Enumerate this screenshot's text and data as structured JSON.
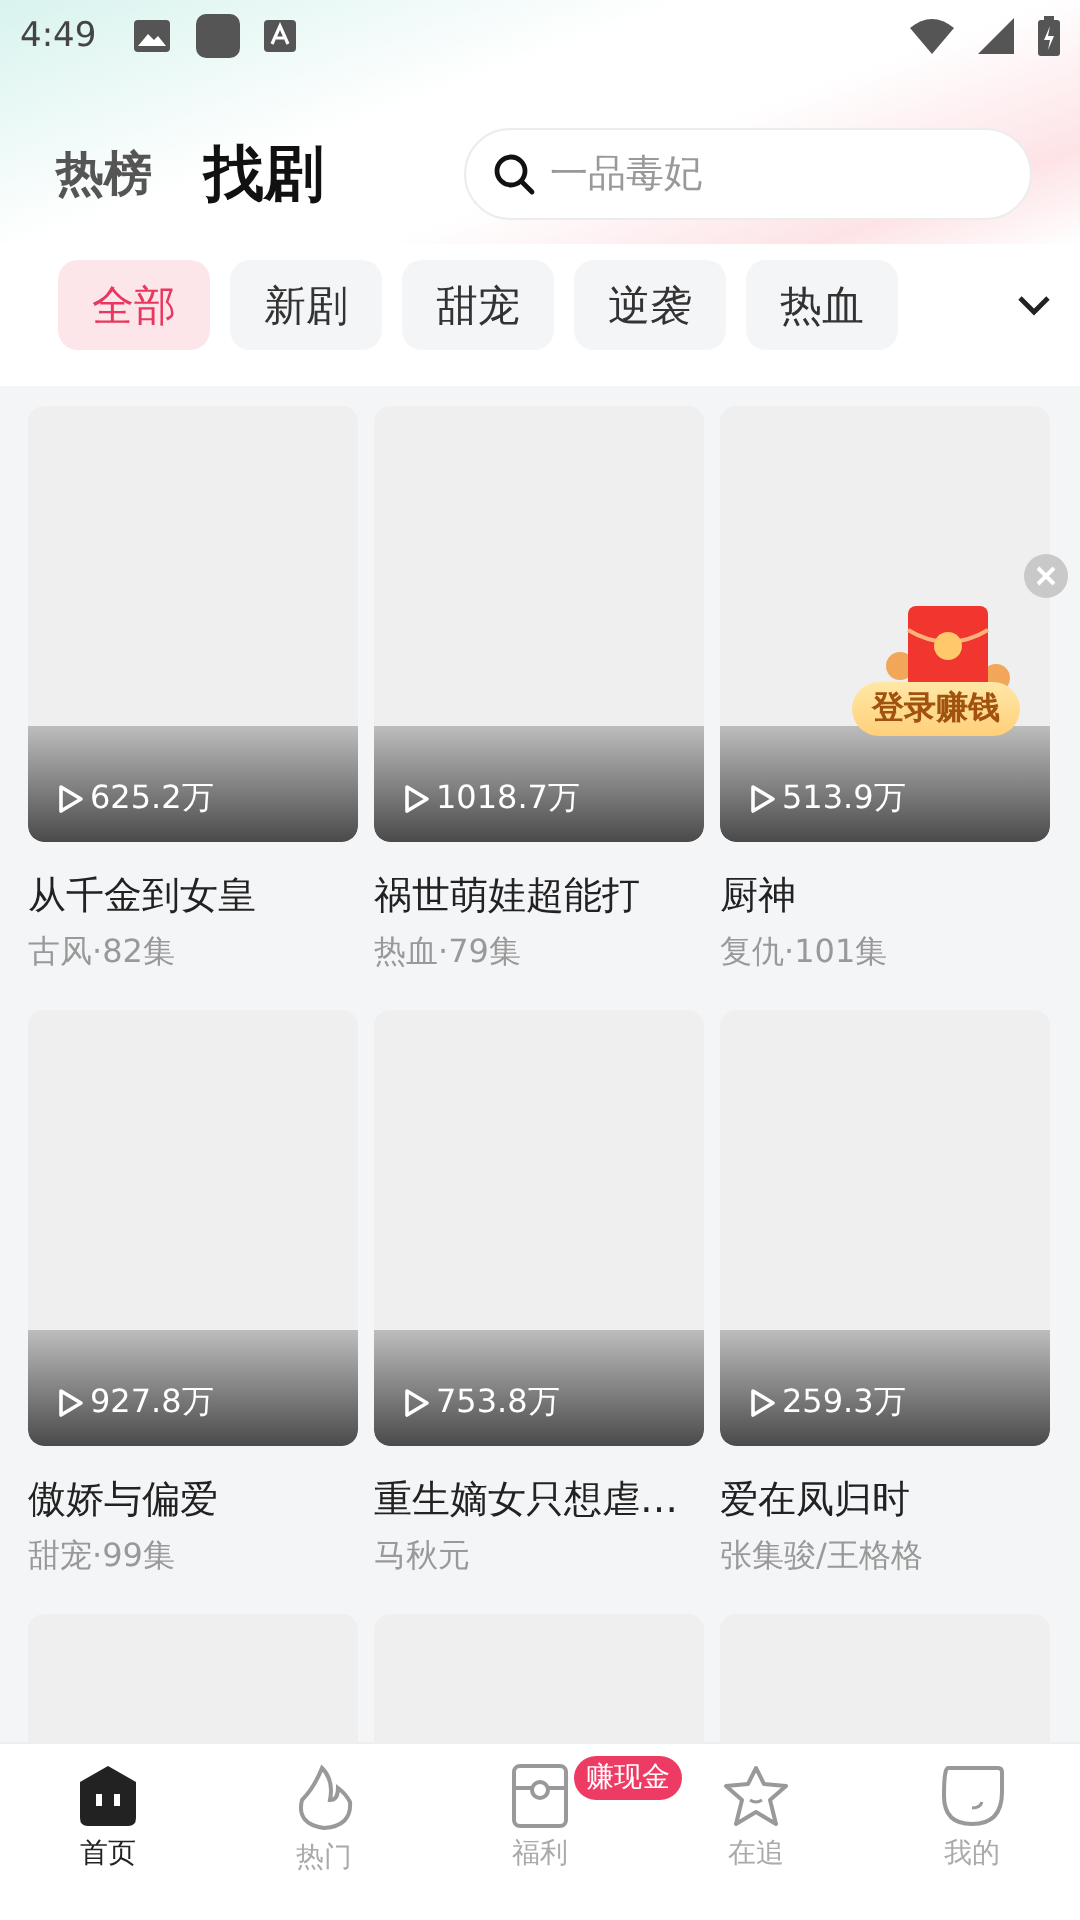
{
  "status_bar": {
    "time": "4:49"
  },
  "tabs": [
    {
      "label": "热榜",
      "selected": false
    },
    {
      "label": "找剧",
      "selected": true
    }
  ],
  "search": {
    "placeholder": "一品毒妃"
  },
  "categories": [
    {
      "label": "全部",
      "selected": true
    },
    {
      "label": "新剧",
      "selected": false
    },
    {
      "label": "甜宠",
      "selected": false
    },
    {
      "label": "逆袭",
      "selected": false
    },
    {
      "label": "热血",
      "selected": false
    }
  ],
  "dramas": [
    {
      "kind": "drama",
      "plays": "625.2万",
      "title": "从千金到女皇",
      "meta": "古风·82集"
    },
    {
      "kind": "drama",
      "plays": "1018.7万",
      "title": "祸世萌娃超能打",
      "meta": "热血·79集"
    },
    {
      "kind": "drama",
      "plays": "513.9万",
      "title": "厨神",
      "meta": "复仇·101集"
    },
    {
      "kind": "drama",
      "plays": "927.8万",
      "title": "傲娇与偏爱",
      "meta": "甜宠·99集"
    },
    {
      "kind": "drama",
      "plays": "753.8万",
      "title": "重生嫡女只想虐…",
      "meta": "马秋元"
    },
    {
      "kind": "drama",
      "plays": "259.3万",
      "title": "爱在凤归时",
      "meta": "张集骏/王格格"
    },
    {
      "kind": "blank"
    },
    {
      "kind": "blank"
    },
    {
      "kind": "blank"
    }
  ],
  "promo": {
    "label": "登录赚钱"
  },
  "nav": [
    {
      "label": "首页",
      "selected": true
    },
    {
      "label": "热门",
      "selected": false
    },
    {
      "label": "福利",
      "selected": false,
      "badge": "赚现金"
    },
    {
      "label": "在追",
      "selected": false
    },
    {
      "label": "我的",
      "selected": false
    }
  ]
}
